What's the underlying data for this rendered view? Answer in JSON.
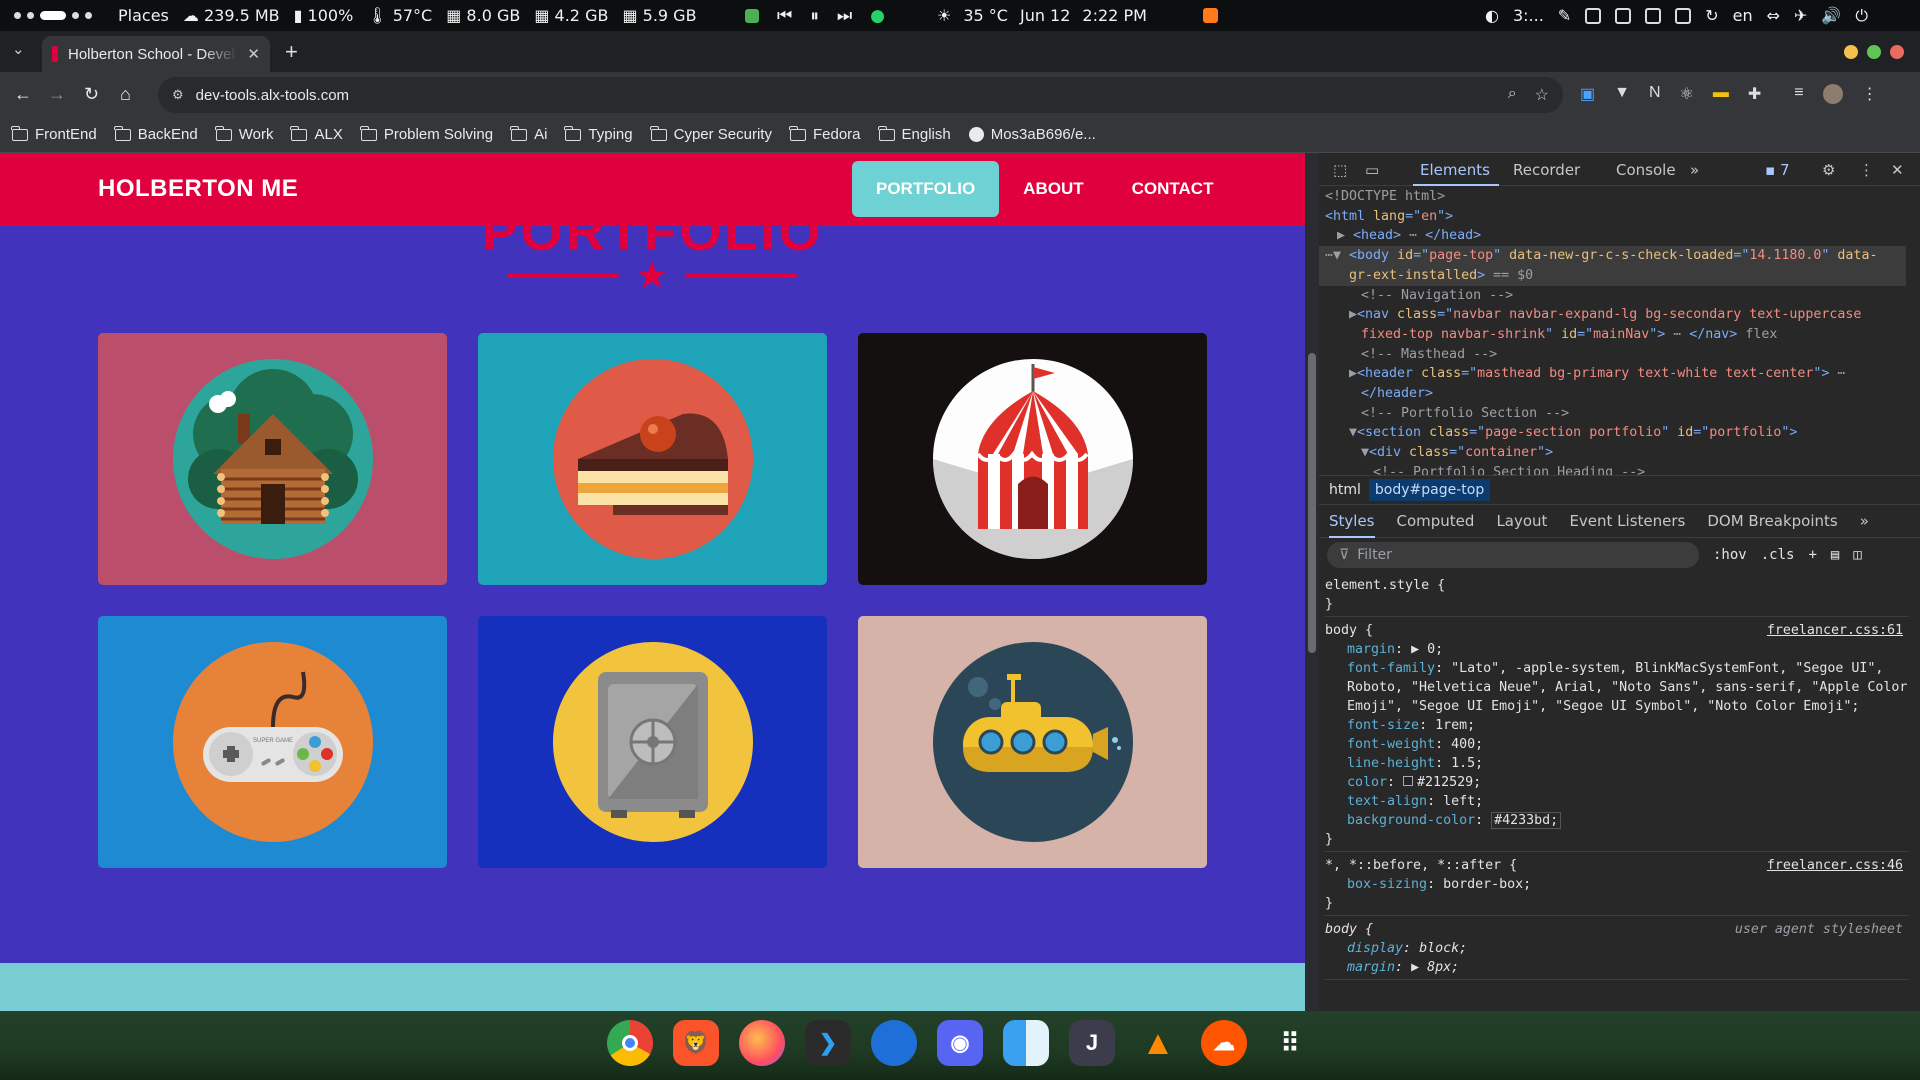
{
  "system_bar": {
    "places": "Places",
    "disk": "239.5 MB",
    "battery": "100%",
    "temp": "57°C",
    "mem1": "8.0 GB",
    "mem2": "4.2 GB",
    "mem3": "5.9 GB",
    "weather": "35 °C",
    "date": "Jun 12",
    "time": "2:22 PM",
    "tray_label": "3:...",
    "lang": "en"
  },
  "browser": {
    "tab_title": "Holberton School - Developer",
    "url": "dev-tools.alx-tools.com",
    "bookmarks": [
      "FrontEnd",
      "BackEnd",
      "Work",
      "ALX",
      "Problem Solving",
      "Ai",
      "Typing",
      "Cyper Security",
      "Fedora",
      "English"
    ],
    "github_bookmark": "Mos3aB696/e..."
  },
  "page": {
    "brand": "HOLBERTON ME",
    "nav": [
      "PORTFOLIO",
      "ABOUT",
      "CONTACT"
    ],
    "heading": "PORTFOLIO",
    "cards": [
      {
        "name": "cabin",
        "bg": "#bb4f6b"
      },
      {
        "name": "cake",
        "bg": "#1fa3b8"
      },
      {
        "name": "circus-tent",
        "bg": "#141010"
      },
      {
        "name": "game-controller",
        "bg": "#1e8ad1"
      },
      {
        "name": "safe",
        "bg": "#1530bd"
      },
      {
        "name": "submarine",
        "bg": "#d6b3a8"
      }
    ],
    "controller_label": "SUPER GAME"
  },
  "devtools": {
    "tabs": [
      "Elements",
      "Recorder",
      "Console"
    ],
    "issues_count": "7",
    "dom_lines": [
      {
        "indent": 0,
        "parts": [
          [
            "cmt",
            "<!DOCTYPE html>"
          ]
        ]
      },
      {
        "indent": 0,
        "parts": [
          [
            "tag",
            "<html "
          ],
          [
            "attr",
            "lang"
          ],
          [
            "tag",
            "=\""
          ],
          [
            "val",
            "en"
          ],
          [
            "tag",
            "\">"
          ]
        ]
      },
      {
        "indent": 1,
        "parts": [
          [
            "cmt",
            "▶ "
          ],
          [
            "tag",
            "<head>"
          ],
          [
            "cmt",
            " ⋯ "
          ],
          [
            "tag",
            "</head>"
          ]
        ]
      },
      {
        "indent": 0,
        "parts": [
          [
            "cmt",
            "⋯▼ "
          ],
          [
            "tag",
            "<body "
          ],
          [
            "attr",
            "id"
          ],
          [
            "tag",
            "=\""
          ],
          [
            "val",
            "page-top"
          ],
          [
            "tag",
            "\" "
          ],
          [
            "attr",
            "data-new-gr-c-s-check-loaded"
          ],
          [
            "tag",
            "=\""
          ],
          [
            "val",
            "14.1180.0"
          ],
          [
            "tag",
            "\" "
          ],
          [
            "attr",
            "data-"
          ]
        ],
        "sel": true
      },
      {
        "indent": 2,
        "parts": [
          [
            "attr",
            "gr-ext-installed"
          ],
          [
            "tag",
            ">"
          ],
          [
            "cmt",
            " == $0"
          ]
        ],
        "sel": true
      },
      {
        "indent": 3,
        "parts": [
          [
            "cmt",
            "<!-- Navigation -->"
          ]
        ]
      },
      {
        "indent": 2,
        "parts": [
          [
            "cmt",
            "▶"
          ],
          [
            "tag",
            "<nav "
          ],
          [
            "attr",
            "class"
          ],
          [
            "tag",
            "=\""
          ],
          [
            "val",
            "navbar navbar-expand-lg bg-secondary text-uppercase"
          ]
        ]
      },
      {
        "indent": 3,
        "parts": [
          [
            "val",
            "fixed-top navbar-shrink"
          ],
          [
            "tag",
            "\" "
          ],
          [
            "attr",
            "id"
          ],
          [
            "tag",
            "=\""
          ],
          [
            "val",
            "mainNav"
          ],
          [
            "tag",
            "\">"
          ],
          [
            "cmt",
            " ⋯ "
          ],
          [
            "tag",
            "</nav>"
          ],
          [
            "cmt",
            " flex"
          ]
        ]
      },
      {
        "indent": 3,
        "parts": [
          [
            "cmt",
            "<!-- Masthead -->"
          ]
        ]
      },
      {
        "indent": 2,
        "parts": [
          [
            "cmt",
            "▶"
          ],
          [
            "tag",
            "<header "
          ],
          [
            "attr",
            "class"
          ],
          [
            "tag",
            "=\""
          ],
          [
            "val",
            "masthead bg-primary text-white text-center"
          ],
          [
            "tag",
            "\">"
          ],
          [
            "cmt",
            " ⋯"
          ]
        ]
      },
      {
        "indent": 3,
        "parts": [
          [
            "tag",
            "</header>"
          ]
        ]
      },
      {
        "indent": 3,
        "parts": [
          [
            "cmt",
            "<!-- Portfolio Section -->"
          ]
        ]
      },
      {
        "indent": 2,
        "parts": [
          [
            "cmt",
            "▼"
          ],
          [
            "tag",
            "<section "
          ],
          [
            "attr",
            "class"
          ],
          [
            "tag",
            "=\""
          ],
          [
            "val",
            "page-section portfolio"
          ],
          [
            "tag",
            "\" "
          ],
          [
            "attr",
            "id"
          ],
          [
            "tag",
            "=\""
          ],
          [
            "val",
            "portfolio"
          ],
          [
            "tag",
            "\">"
          ]
        ]
      },
      {
        "indent": 3,
        "parts": [
          [
            "cmt",
            "▼"
          ],
          [
            "tag",
            "<div "
          ],
          [
            "attr",
            "class"
          ],
          [
            "tag",
            "=\""
          ],
          [
            "val",
            "container"
          ],
          [
            "tag",
            "\">"
          ]
        ]
      },
      {
        "indent": 4,
        "parts": [
          [
            "cmt",
            "<!-- Portfolio Section Heading -->"
          ]
        ]
      }
    ],
    "breadcrumbs": [
      "html",
      "body#page-top"
    ],
    "style_tabs": [
      "Styles",
      "Computed",
      "Layout",
      "Event Listeners",
      "DOM Breakpoints"
    ],
    "filter_placeholder": "Filter",
    "hov": ":hov",
    "cls": ".cls",
    "rules": [
      {
        "selector": "element.style {",
        "source": "",
        "props": [],
        "close": "}"
      },
      {
        "selector": "body {",
        "source": "freelancer.css:61",
        "props": [
          [
            "margin",
            "▶ 0;"
          ],
          [
            "font-family",
            "\"Lato\", -apple-system, BlinkMacSystemFont, \"Segoe UI\", Roboto, \"Helvetica Neue\", Arial, \"Noto Sans\", sans-serif, \"Apple Color Emoji\", \"Segoe UI Emoji\", \"Segoe UI Symbol\", \"Noto Color Emoji\";"
          ],
          [
            "font-size",
            "1rem;"
          ],
          [
            "font-weight",
            "400;"
          ],
          [
            "line-height",
            "1.5;"
          ],
          [
            "color",
            "#212529;"
          ],
          [
            "text-align",
            "left;"
          ],
          [
            "background-color",
            "#4233bd;"
          ]
        ],
        "close": "}"
      },
      {
        "selector": "*, *::before, *::after {",
        "source": "freelancer.css:46",
        "props": [
          [
            "box-sizing",
            "border-box;"
          ]
        ],
        "close": "}"
      },
      {
        "selector": "body {",
        "source": "user agent stylesheet",
        "props": [
          [
            "display",
            "block;"
          ],
          [
            "margin",
            "▶ 8px;"
          ]
        ],
        "close": ""
      }
    ]
  }
}
